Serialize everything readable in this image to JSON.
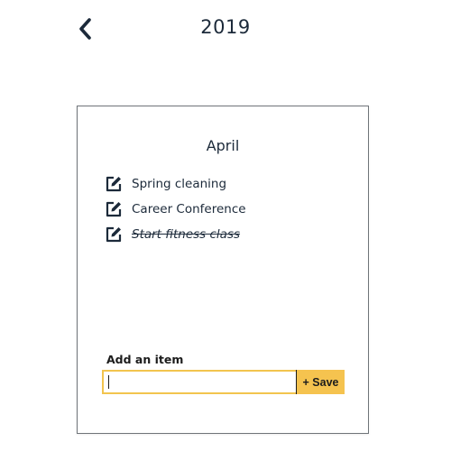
{
  "header": {
    "back_icon": "chevron-left-icon",
    "title": "2019"
  },
  "card": {
    "month": "April",
    "items": [
      {
        "label": "Spring cleaning",
        "completed": false,
        "icon": "edit-icon"
      },
      {
        "label": "Career Conference",
        "completed": false,
        "icon": "edit-icon"
      },
      {
        "label": "Start fitness class",
        "completed": true,
        "icon": "edit-icon"
      }
    ],
    "add_item": {
      "label": "Add an item",
      "input_value": "",
      "save_label": "+ Save"
    }
  },
  "colors": {
    "text": "#1c2a3a",
    "accent": "#f5c34f",
    "input_border": "#f2c44e",
    "card_border": "#6f7479"
  }
}
